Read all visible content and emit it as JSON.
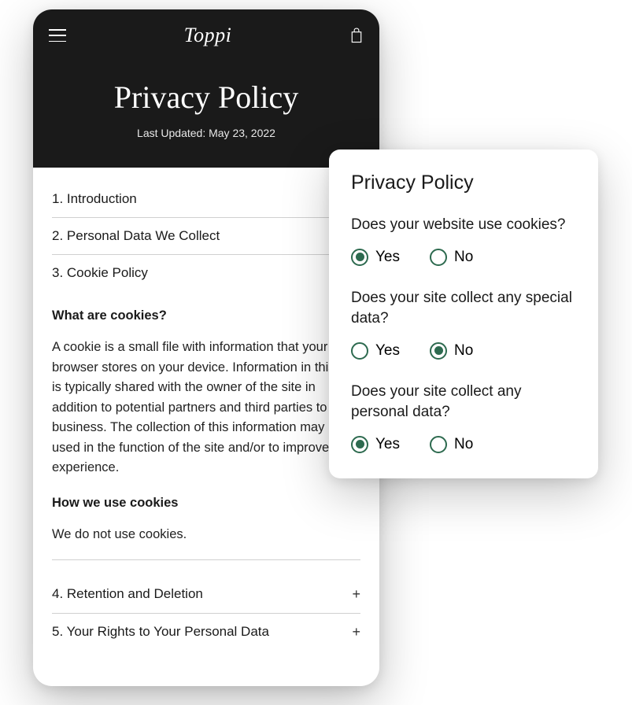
{
  "phone": {
    "logo": "Toppi",
    "title": "Privacy Policy",
    "lastUpdated": "Last Updated: May 23, 2022",
    "toc": {
      "item1": "1. Introduction",
      "item2": "2. Personal Data We Collect",
      "item3": "3. Cookie Policy",
      "item4": "4. Retention and Deletion",
      "item5": "5. Your Rights to Your Personal Data"
    },
    "section3": {
      "sub1": "What are cookies?",
      "body1": "A cookie is a small file with information that your browser stores on your device. Information in this file is typically shared with the owner of the site in addition to potential partners and third parties to that business. The collection of this information may be used in the function of the site and/or to improve your experience.",
      "sub2": "How we use cookies",
      "body2": "We do not use cookies."
    },
    "expandSymbol": "+"
  },
  "form": {
    "title": "Privacy Policy",
    "q1": {
      "text": "Does your website use cookies?",
      "yes": "Yes",
      "no": "No",
      "selected": "yes"
    },
    "q2": {
      "text": "Does your site collect any special data?",
      "yes": "Yes",
      "no": "No",
      "selected": "no"
    },
    "q3": {
      "text": "Does your site collect any personal data?",
      "yes": "Yes",
      "no": "No",
      "selected": "yes"
    }
  },
  "colors": {
    "accent": "#2d6a4f",
    "dark": "#1a1a1a"
  }
}
